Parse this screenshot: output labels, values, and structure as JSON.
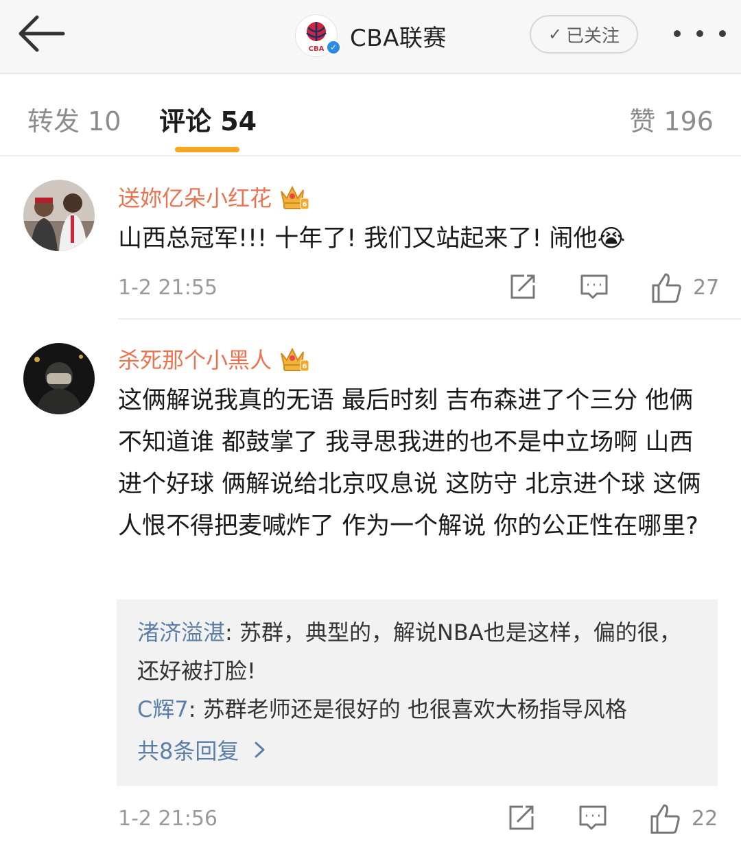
{
  "header": {
    "account_name": "CBA联赛",
    "logo_text": "CBA",
    "follow_label": "已关注",
    "back_icon": "arrow-left-icon",
    "more_icon": "more-dots-icon"
  },
  "tabs": {
    "repost": "转发 10",
    "comments": "评论 54",
    "likes": "赞 196"
  },
  "colors": {
    "accent": "#f5a623",
    "username": "#eb7350",
    "reply_user": "#5b7fa6"
  },
  "comments": [
    {
      "username": "送妳亿朵小红花",
      "text": "山西总冠军!!! 十年了! 我们又站起来了! 闹他😭",
      "time": "1-2 21:55",
      "likes": "27"
    },
    {
      "username": "杀死那个小黑人",
      "text": "这俩解说我真的无语 最后时刻 吉布森进了个三分 他俩不知道谁 都鼓掌了 我寻思我进的也不是中立场啊 山西进个好球 俩解说给北京叹息说 这防守 北京进个球 这俩人恨不得把麦喊炸了 作为一个解说 你的公正性在哪里?",
      "time": "1-2 21:56",
      "likes": "22",
      "replies": [
        {
          "user": "渚济溢湛",
          "text": ": 苏群，典型的，解说NBA也是这样，偏的很，还好被打脸!"
        },
        {
          "user": "C辉7",
          "text": ": 苏群老师还是很好的 也很喜欢大杨指导风格"
        }
      ],
      "more_replies": "共8条回复"
    }
  ]
}
